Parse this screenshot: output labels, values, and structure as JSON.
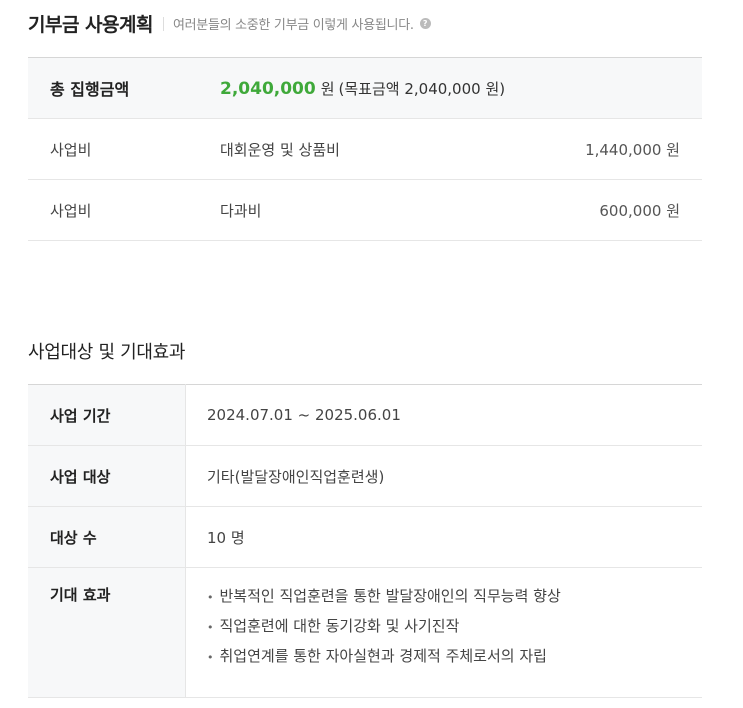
{
  "donation_plan": {
    "title": "기부금 사용계획",
    "subtitle": "여러분들의 소중한 기부금 이렇게 사용됩니다.",
    "help_icon_glyph": "?",
    "total": {
      "label": "총 집행금액",
      "amount": "2,040,000",
      "unit": "원",
      "goal_text": "(목표금액 2,040,000 원)"
    },
    "rows": [
      {
        "category": "사업비",
        "item": "대회운영 및 상품비",
        "amount": "1,440,000 원"
      },
      {
        "category": "사업비",
        "item": "다과비",
        "amount": "600,000 원"
      }
    ]
  },
  "business_target": {
    "title": "사업대상 및 기대효과",
    "period_label": "사업 기간",
    "period_value": "2024.07.01 ~ 2025.06.01",
    "target_label": "사업 대상",
    "target_value": "기타(발달장애인직업훈련생)",
    "count_label": "대상 수",
    "count_value": "10 명",
    "effect_label": "기대 효과",
    "effects": [
      "반복적인 직업훈련을 통한 발달장애인의 직무능력 향상",
      "직업훈련에 대한 동기강화 및 사기진작",
      "취업연계를 통한 자아실현과 경제적 주체로서의 자립"
    ]
  },
  "colors": {
    "accent_green": "#3fa93a",
    "header_bg": "#f7f8f9",
    "divider": "#e6e6e6"
  }
}
